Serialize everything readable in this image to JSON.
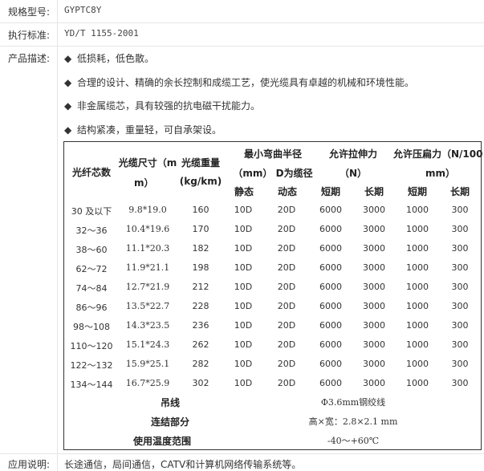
{
  "model": {
    "label": "规格型号:",
    "value": "GYPTC8Y"
  },
  "standard": {
    "label": "执行标准:",
    "value": "YD/T 1155-2001"
  },
  "description": {
    "label": "产品描述:",
    "bullet_symbol": "◆",
    "items": [
      "低损耗，低色散。",
      "合理的设计、精确的余长控制和成缆工艺，使光缆具有卓越的机械和环境性能。",
      "非金属缆芯，具有较强的抗电磁干扰能力。",
      "结构紧凑，重量轻，可自承架设。"
    ]
  },
  "table": {
    "headers": {
      "fiber_count": "光纤芯数",
      "size_a": "光缆尺寸（m",
      "size_b": "m）",
      "weight_a": "光缆重量",
      "weight_b": "(kg/km)",
      "bend_a": "最小弯曲半径",
      "bend_b": "（mm） D为缆径",
      "bend_static": "静态",
      "bend_dynamic": "动态",
      "tensile_a": "允许拉伸力",
      "tensile_b": "（N）",
      "tensile_short": "短期",
      "tensile_long": "长期",
      "crush_a": "允许压扁力（N/100",
      "crush_b": "mm）",
      "crush_short": "短期",
      "crush_long": "长期"
    },
    "rows": [
      [
        "30 及以下",
        "9.8*19.0",
        "160",
        "10D",
        "20D",
        "6000",
        "3000",
        "1000",
        "300"
      ],
      [
        "32～36",
        "10.4*19.6",
        "170",
        "10D",
        "20D",
        "6000",
        "3000",
        "1000",
        "300"
      ],
      [
        "38～60",
        "11.1*20.3",
        "182",
        "10D",
        "20D",
        "6000",
        "3000",
        "1000",
        "300"
      ],
      [
        "62～72",
        "11.9*21.1",
        "198",
        "10D",
        "20D",
        "6000",
        "3000",
        "1000",
        "300"
      ],
      [
        "74～84",
        "12.7*21.9",
        "212",
        "10D",
        "20D",
        "6000",
        "3000",
        "1000",
        "300"
      ],
      [
        "86～96",
        "13.5*22.7",
        "228",
        "10D",
        "20D",
        "6000",
        "3000",
        "1000",
        "300"
      ],
      [
        "98～108",
        "14.3*23.5",
        "236",
        "10D",
        "20D",
        "6000",
        "3000",
        "1000",
        "300"
      ],
      [
        "110～120",
        "15.1*24.3",
        "262",
        "10D",
        "20D",
        "6000",
        "3000",
        "1000",
        "300"
      ],
      [
        "122～132",
        "15.9*25.1",
        "282",
        "10D",
        "20D",
        "6000",
        "3000",
        "1000",
        "300"
      ],
      [
        "134～144",
        "16.7*25.9",
        "302",
        "10D",
        "20D",
        "6000",
        "3000",
        "1000",
        "300"
      ]
    ],
    "extra": [
      {
        "label": "吊线",
        "value": "Φ3.6mm钢绞线"
      },
      {
        "label": "连结部分",
        "value": "高×宽：2.8×2.1 mm"
      },
      {
        "label": "使用温度范围",
        "value": "-40～+60℃"
      }
    ]
  },
  "application": {
    "label": "应用说明:",
    "value": "长途通信，局间通信，CATV和计算机网络传输系统等。"
  }
}
